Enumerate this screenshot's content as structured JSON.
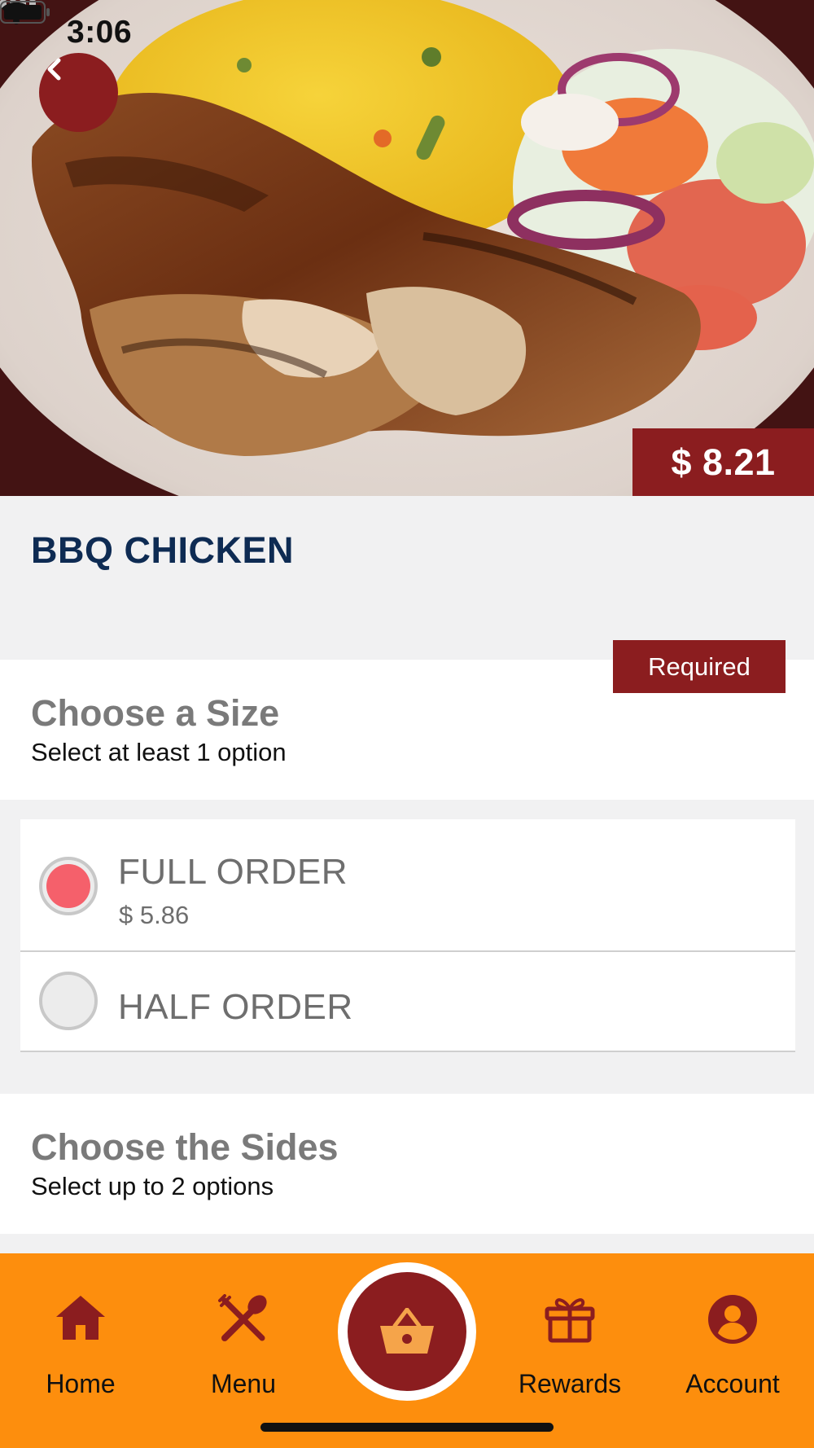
{
  "status_bar": {
    "time": "3:06"
  },
  "product": {
    "title": "BBQ CHICKEN",
    "price": "$ 8.21",
    "image_alt": "Grilled BBQ chicken with yellow rice and salad"
  },
  "size_section": {
    "heading": "Choose a Size",
    "subtitle": "Select at least 1 option",
    "required_label": "Required",
    "options": [
      {
        "label": "FULL ORDER",
        "price": "$ 5.86",
        "selected": true
      },
      {
        "label": "HALF ORDER",
        "price": "",
        "selected": false
      }
    ]
  },
  "sides_section": {
    "heading": "Choose the Sides",
    "subtitle": "Select up to 2 options"
  },
  "tab_bar": {
    "items": [
      {
        "label": "Home",
        "icon": "home-icon"
      },
      {
        "label": "Menu",
        "icon": "utensils-icon"
      },
      {
        "label": "Rewards",
        "icon": "gift-icon"
      },
      {
        "label": "Account",
        "icon": "account-icon"
      }
    ],
    "cart_icon": "basket-icon"
  },
  "colors": {
    "brand_red": "#8b1d1f",
    "tab_orange": "#fd8e0d",
    "title_navy": "#0e2b53",
    "radio_selected": "#f5606b"
  }
}
